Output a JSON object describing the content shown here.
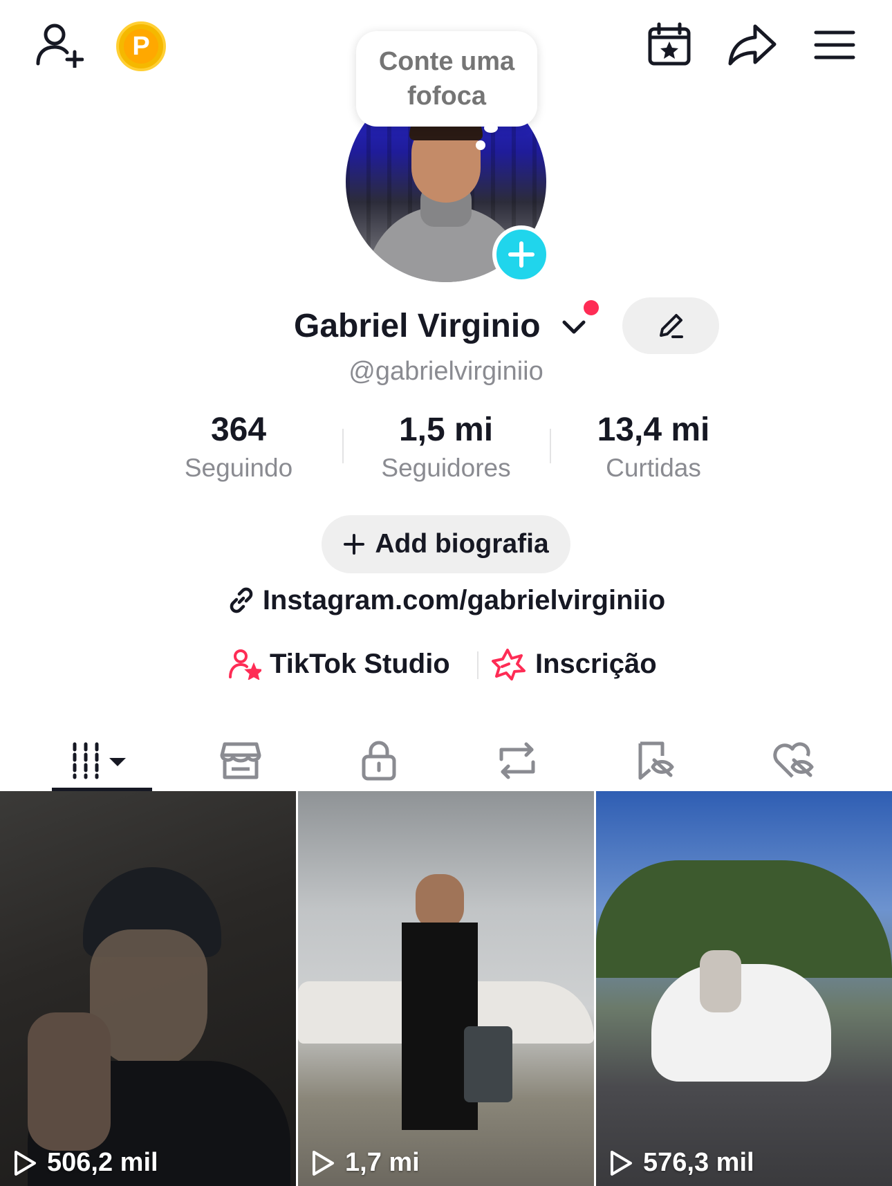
{
  "bubble": {
    "text": "Conte uma fofoca"
  },
  "profile": {
    "name": "Gabriel Virginio",
    "handle": "@gabrielvirginiio"
  },
  "stats": [
    {
      "value": "364",
      "label": "Seguindo"
    },
    {
      "value": "1,5 mi",
      "label": "Seguidores"
    },
    {
      "value": "13,4 mi",
      "label": "Curtidas"
    }
  ],
  "bio_button": {
    "label": "Add biografia"
  },
  "link": {
    "text": "Instagram.com/gabrielvirginiio"
  },
  "shortcuts": [
    {
      "label": "TikTok Studio",
      "icon": "person-star-icon"
    },
    {
      "label": "Inscrição",
      "icon": "star-outline-icon"
    }
  ],
  "tabs": [
    "videos-grid-icon",
    "shop-icon",
    "lock-icon",
    "repost-icon",
    "saved-hidden-icon",
    "liked-hidden-icon"
  ],
  "videos": [
    {
      "views": "506,2 mil"
    },
    {
      "views": "1,7 mi"
    },
    {
      "views": "576,3 mil"
    }
  ],
  "colors": {
    "accent": "#fe2c55",
    "add_button": "#20d5ec",
    "coin": "#ffa800"
  }
}
